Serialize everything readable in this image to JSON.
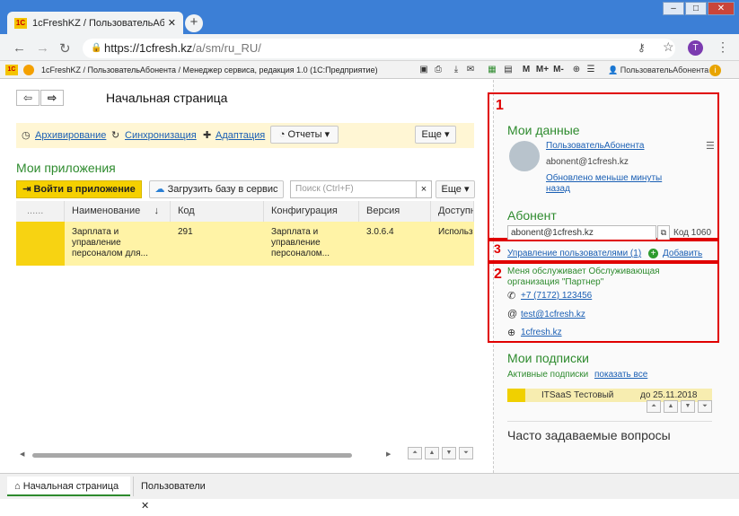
{
  "browser": {
    "tab_title": "1cFreshKZ / ПользовательАбоненнта",
    "url_host": "https://1cfresh.kz",
    "url_path": "/a/sm/ru_RU/",
    "avatar": "T",
    "new_tab": "+"
  },
  "app": {
    "header": "1cFreshKZ / ПользовательАбонента / Менеджер сервиса, редакция 1.0  (1С:Предприятие)",
    "user": "ПользовательАбонента",
    "m_labels": [
      "M",
      "M+",
      "M-"
    ]
  },
  "page": {
    "title": "Начальная страница"
  },
  "toolbar": {
    "archiving": "Архивирование",
    "sync": "Синхронизация",
    "adaptation": "Адаптация",
    "reports": "Отчеты",
    "more": "Еще"
  },
  "apps": {
    "title": "Мои приложения",
    "login": "Войти в приложение",
    "upload": "Загрузить базу в сервис",
    "search_placeholder": "Поиск (Ctrl+F)",
    "more": "Еще",
    "columns": [
      "......",
      "Наименование",
      "Код",
      "Конфигурация",
      "Версия",
      "Доступн"
    ],
    "row": {
      "name": "Зарплата и управление персоналом для...",
      "code": "291",
      "config": "Зарплата и управление персоналом...",
      "version": "3.0.6.4",
      "access": "Использ"
    }
  },
  "right": {
    "n1": "1",
    "my_data": "Мои данные",
    "user": "ПользовательАбонента",
    "email": "abonent@1cfresh.kz",
    "updated": "Обновлено меньше минуты назад",
    "subscriber": "Абонент",
    "sub_email": "abonent@1cfresh.kz",
    "code": "Код 1060",
    "n3": "3",
    "manage": "Управление пользователями (1)",
    "add": "Добавить",
    "n2": "2",
    "service_org": "Меня обслуживает Обслуживающая организация \"Партнер\"",
    "phone": "+7 (7172) 123456",
    "mail": "test@1cfresh.kz",
    "site": "1cfresh.kz",
    "subs_title": "Мои подписки",
    "active": "Активные подписки",
    "show_all": "показать все",
    "sub_name": "ITSaaS Тестовый",
    "sub_date": "до 25.11.2018",
    "faq": "Часто задаваемые вопросы"
  },
  "bottom": {
    "tab1": "Начальная страница",
    "tab2": "Пользователи"
  }
}
